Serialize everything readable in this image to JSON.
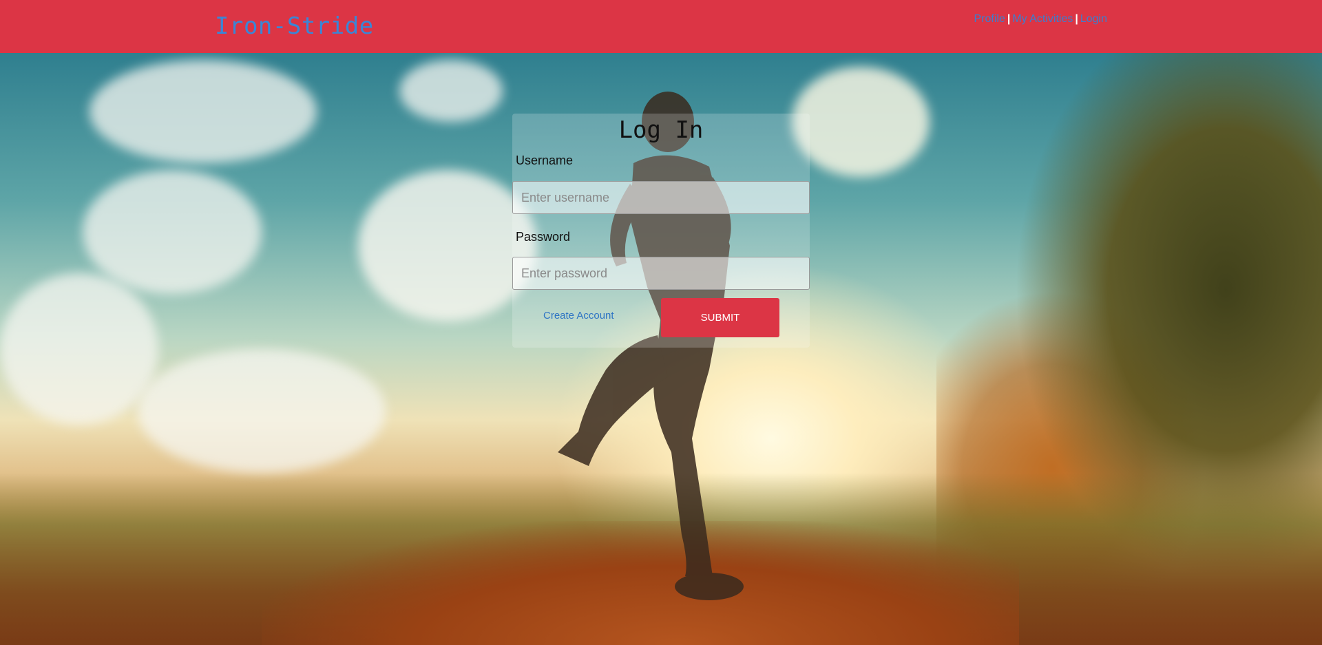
{
  "nav": {
    "brand": "Iron-Stride",
    "links": [
      "Profile",
      "My Activities",
      "Login"
    ],
    "separator": "|"
  },
  "login": {
    "title": "Log In",
    "username_label": "Username",
    "username_placeholder": "Enter username",
    "password_label": "Password",
    "password_placeholder": "Enter password",
    "create_account": "Create Account",
    "submit_label": "SUBMIT"
  },
  "colors": {
    "accent": "#dc3545",
    "brand_text": "#3a86d6",
    "link": "#2d74c4"
  }
}
